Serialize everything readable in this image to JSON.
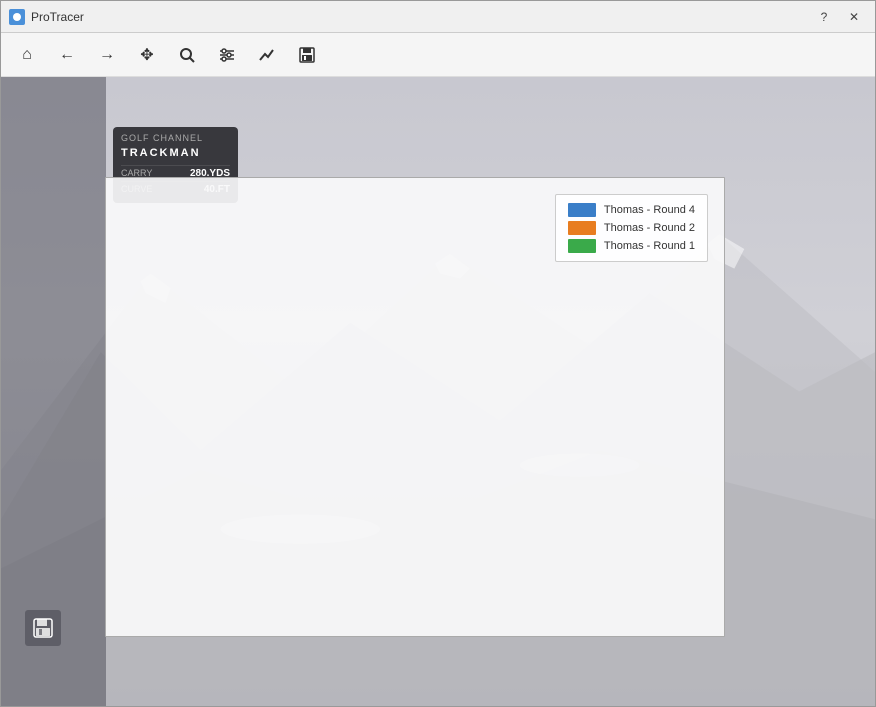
{
  "window": {
    "title": "ProTracer",
    "help_btn": "?",
    "close_btn": "✕"
  },
  "toolbar": {
    "buttons": [
      {
        "id": "home",
        "icon": "⌂",
        "label": "Home"
      },
      {
        "id": "back",
        "icon": "←",
        "label": "Back"
      },
      {
        "id": "forward",
        "icon": "→",
        "label": "Forward"
      },
      {
        "id": "move",
        "icon": "✥",
        "label": "Move"
      },
      {
        "id": "search",
        "icon": "🔍",
        "label": "Search/Zoom"
      },
      {
        "id": "settings",
        "icon": "⚙",
        "label": "Settings"
      },
      {
        "id": "chart",
        "icon": "📈",
        "label": "Chart"
      },
      {
        "id": "save",
        "icon": "💾",
        "label": "Save"
      }
    ]
  },
  "trackman": {
    "header_label": "GOLF CHANNEL",
    "brand": "TRACKMAN",
    "row1_label": "CARRY",
    "row1_value": "280.YDS",
    "row2_label": "CURVE",
    "row2_value": "40.FT"
  },
  "legend": {
    "items": [
      {
        "label": "Thomas - Round 4",
        "color": "#3a7ec8"
      },
      {
        "label": "Thomas - Round 2",
        "color": "#e87d20"
      },
      {
        "label": "Thomas - Round 1",
        "color": "#3aaa4a"
      }
    ]
  }
}
